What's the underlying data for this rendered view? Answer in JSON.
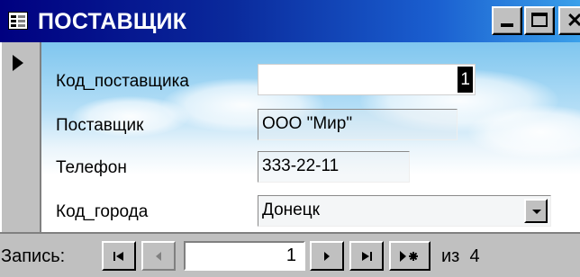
{
  "window": {
    "title": "ПОСТАВЩИК",
    "title_color": "#ffffff",
    "titlebar_gradient": [
      "#000080",
      "#3aa0ea"
    ]
  },
  "form": {
    "fields": [
      {
        "label": "Код_поставщика",
        "value": "1",
        "state": "focused"
      },
      {
        "label": "Поставщик",
        "value": "ООО \"Мир\"",
        "state": "readonly"
      },
      {
        "label": "Телефон",
        "value": "333-22-11",
        "state": "readonly"
      },
      {
        "label": "Код_города",
        "value": "Донецк",
        "state": "combo"
      }
    ]
  },
  "navigation": {
    "label": "Запись:",
    "current": "1",
    "total_text": "из  4",
    "buttons": [
      "first-record",
      "previous-record",
      "next-record",
      "last-record",
      "new-record"
    ]
  }
}
